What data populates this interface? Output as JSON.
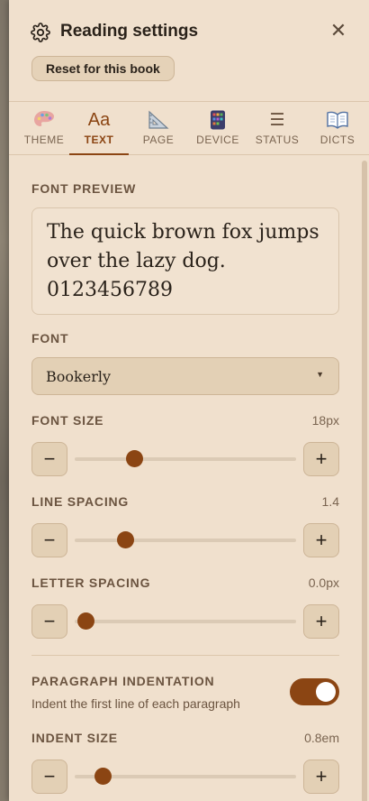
{
  "header": {
    "title": "Reading settings",
    "reset_label": "Reset for this book"
  },
  "tabs": [
    {
      "label": "THEME",
      "icon": "palette-icon",
      "active": false
    },
    {
      "label": "TEXT",
      "icon": "text-icon",
      "glyph": "Aa",
      "active": true
    },
    {
      "label": "PAGE",
      "icon": "triangle-ruler-icon",
      "active": false
    },
    {
      "label": "DEVICE",
      "icon": "device-icon",
      "active": false
    },
    {
      "label": "STATUS",
      "icon": "menu-lines-icon",
      "glyph": "☰",
      "active": false
    },
    {
      "label": "DICTS",
      "icon": "open-book-icon",
      "active": false
    }
  ],
  "preview": {
    "label": "FONT PREVIEW",
    "line1": "The quick brown fox jumps",
    "line2": "over the lazy dog.",
    "line3": "0123456789"
  },
  "font": {
    "label": "FONT",
    "value": "Bookerly"
  },
  "font_size": {
    "label": "FONT SIZE",
    "value": "18px",
    "slider_fraction": 0.27
  },
  "line_spacing": {
    "label": "LINE SPACING",
    "value": "1.4",
    "slider_fraction": 0.23
  },
  "letter_spacing": {
    "label": "LETTER SPACING",
    "value": "0.0px",
    "slider_fraction": 0.05
  },
  "paragraph_indentation": {
    "label": "PARAGRAPH INDENTATION",
    "description": "Indent the first line of each paragraph",
    "enabled": true
  },
  "indent_size": {
    "label": "INDENT SIZE",
    "value": "0.8em",
    "slider_fraction": 0.13
  },
  "stepper": {
    "minus": "−",
    "plus": "+"
  },
  "colors": {
    "accent": "#8b4513",
    "panel_bg": "#f0e0cd",
    "button_bg": "#e3d0b5"
  }
}
